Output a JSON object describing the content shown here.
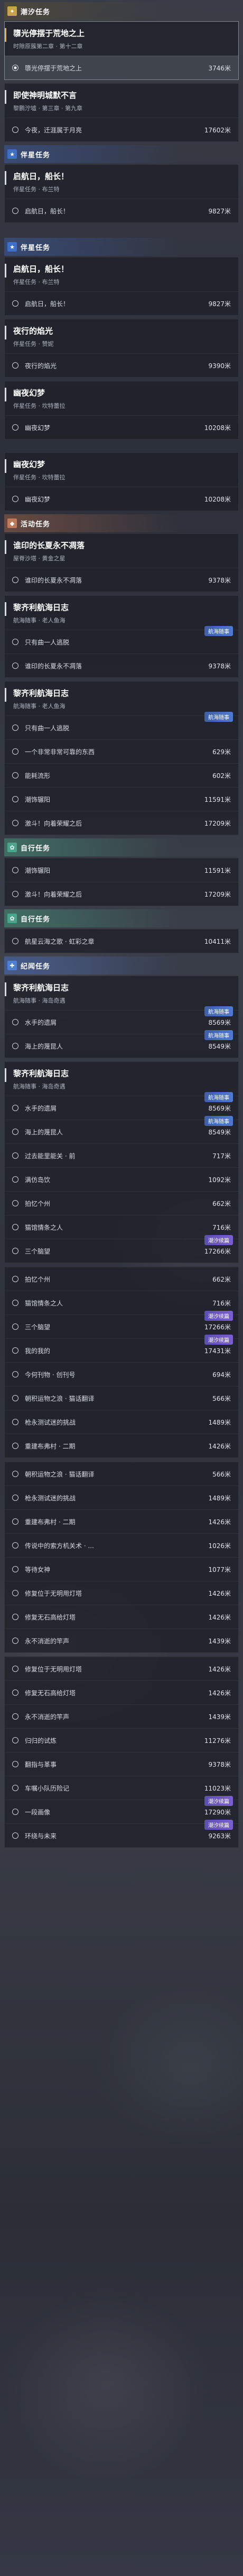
{
  "sections": [
    {
      "type": "header",
      "variant": "hc",
      "icon": "✦",
      "icon_name": "tide-task-icon",
      "title": "潮汐任务"
    },
    {
      "type": "card",
      "variant": "hc-card",
      "selected": true,
      "title": "隳光停摆于荒地之上",
      "subtitle": "时隙原簇第二章 · 第十二章",
      "steps": [
        {
          "text": "隳光停摆于荒地之上",
          "dist": "3746米",
          "marker": "dot",
          "highlight": true
        }
      ]
    },
    {
      "type": "card",
      "title": "即使神明城默不言",
      "subtitle": "黎鹏泞墟 · 第三章 · 第九章",
      "steps": [
        {
          "text": "今夜，迁涯属于月亮",
          "dist": "17602米"
        }
      ]
    },
    {
      "type": "header",
      "variant": "xq",
      "icon": "★",
      "icon_name": "companion-task-icon",
      "title": "伴星任务"
    },
    {
      "type": "card",
      "title": "启航日，船长！",
      "subtitle": "伴星任务 · 布兰特",
      "steps": [
        {
          "text": "启航日，船长！",
          "dist": "9827米"
        }
      ]
    },
    {
      "type": "gap"
    },
    {
      "type": "header",
      "variant": "xq",
      "icon": "★",
      "icon_name": "companion-task-icon",
      "title": "伴星任务"
    },
    {
      "type": "card",
      "title": "启航日，船长！",
      "subtitle": "伴星任务 · 布兰特",
      "steps": [
        {
          "text": "启航日，船长！",
          "dist": "9827米"
        }
      ]
    },
    {
      "type": "card",
      "title": "夜行的焰光",
      "subtitle": "伴星任务 · 赞妮",
      "steps": [
        {
          "text": "夜行的焰光",
          "dist": "9390米"
        }
      ]
    },
    {
      "type": "card",
      "title": "幽夜幻梦",
      "subtitle": "伴星任务 · 坎特蕾拉",
      "steps": [
        {
          "text": "幽夜幻梦",
          "dist": "10208米"
        }
      ]
    },
    {
      "type": "gap"
    },
    {
      "type": "card",
      "title": "幽夜幻梦",
      "subtitle": "伴星任务 · 坎特蕾拉",
      "steps": [
        {
          "text": "幽夜幻梦",
          "dist": "10208米"
        }
      ]
    },
    {
      "type": "header",
      "variant": "hd",
      "icon": "◆",
      "icon_name": "event-task-icon",
      "title": "活动任务"
    },
    {
      "type": "card",
      "title": "谁印的长夏永不凋落",
      "subtitle": "屋脊沙塔 · 黄金之星",
      "steps": [
        {
          "text": "谁印的长夏永不凋落",
          "dist": "9378米"
        }
      ]
    },
    {
      "type": "card",
      "title": "黎齐利航海日志",
      "subtitle": "航海随事 · 老人鱼海",
      "steps": [
        {
          "text": "只有曲一人逃脱",
          "tag": "航海随事",
          "tag_style": "link"
        },
        {
          "text": "谁印的长夏永不凋落",
          "dist": "9378米"
        }
      ]
    },
    {
      "type": "card",
      "title": "黎齐利航海日志",
      "subtitle": "航海随事 · 老人鱼海",
      "steps": [
        {
          "text": "只有曲一人逃脱",
          "tag": "航海随事",
          "tag_style": "link"
        },
        {
          "text": "一个非常非常可靠的东西",
          "dist": "629米"
        },
        {
          "text": "能耗流形",
          "dist": "602米"
        },
        {
          "text": "潮饰辗阳",
          "dist": "11591米"
        },
        {
          "text": "激斗！向着荣耀之后",
          "dist": "17209米"
        }
      ]
    },
    {
      "type": "header",
      "variant": "zx",
      "icon": "✿",
      "icon_name": "free-task-icon",
      "title": "自行任务"
    },
    {
      "type": "card",
      "title": "",
      "subtitle": "",
      "steps": [
        {
          "text": "潮饰辗阳",
          "dist": "11591米"
        },
        {
          "text": "激斗！向着荣耀之后",
          "dist": "17209米"
        }
      ]
    },
    {
      "type": "header",
      "variant": "zx",
      "icon": "✿",
      "icon_name": "free-task-icon",
      "title": "自行任务"
    },
    {
      "type": "card",
      "title": "",
      "subtitle": "",
      "steps": [
        {
          "text": "航星云海之歌 · 虹彩之章",
          "dist": "10411米"
        }
      ]
    },
    {
      "type": "header",
      "variant": "jl",
      "icon": "✚",
      "icon_name": "record-task-icon",
      "title": "纪闻任务"
    },
    {
      "type": "card",
      "title": "黎齐利航海日志",
      "subtitle": "航海随事 · 海岛奇遇",
      "steps": [
        {
          "text": "水手的遗屑",
          "dist": "8569米",
          "tag": "航海随事",
          "tag_style": "link"
        },
        {
          "text": "海上的蔑昆人",
          "dist": "8549米",
          "tag": "航海随事",
          "tag_style": "link"
        }
      ]
    },
    {
      "type": "card",
      "title": "黎齐利航海日志",
      "subtitle": "航海随事 · 海岛奇遇",
      "steps": [
        {
          "text": "水手的遗屑",
          "dist": "8569米",
          "tag": "航海随事",
          "tag_style": "link"
        },
        {
          "text": "海上的蔑昆人",
          "dist": "8549米",
          "tag": "航海随事",
          "tag_style": "link"
        },
        {
          "text": "过去能里能关 · 前",
          "dist": "717米"
        },
        {
          "text": "满仿岛饮",
          "dist": "1092米"
        },
        {
          "text": "拍忆个州",
          "dist": "662米"
        },
        {
          "text": "猫馆情条之人",
          "dist": "716米"
        },
        {
          "text": "三个脑望",
          "dist": "17266米",
          "tag": "潮汐续篇"
        }
      ]
    },
    {
      "type": "card",
      "title": "",
      "subtitle": "",
      "steps": [
        {
          "text": "拍忆个州",
          "dist": "662米"
        },
        {
          "text": "猫馆情条之人",
          "dist": "716米"
        },
        {
          "text": "三个脑望",
          "dist": "17266米",
          "tag": "潮汐续篇"
        },
        {
          "text": "我的我的",
          "dist": "17431米",
          "tag": "潮汐续篇"
        },
        {
          "text": "今何刊物 · 创刊号",
          "dist": "694米"
        },
        {
          "text": "朝积运物之浪 · 猫话翻译",
          "dist": "566米"
        },
        {
          "text": "枪永测试迷的挑战",
          "dist": "1489米"
        },
        {
          "text": "重建布弗村 · 二期",
          "dist": "1426米"
        }
      ]
    },
    {
      "type": "card",
      "title": "",
      "subtitle": "",
      "steps": [
        {
          "text": "朝积运物之浪 · 猫话翻译",
          "dist": "566米"
        },
        {
          "text": "枪永测试迷的挑战",
          "dist": "1489米"
        },
        {
          "text": "重建布弗村 · 二期",
          "dist": "1426米"
        },
        {
          "text": "传说中的索方机关术 · ...",
          "dist": "1026米"
        },
        {
          "text": "等待女神",
          "dist": "1077米"
        },
        {
          "text": "修复位于无明用灯塔",
          "dist": "1426米"
        },
        {
          "text": "修复无石高给灯塔",
          "dist": "1426米"
        },
        {
          "text": "永不消逝的竿声",
          "dist": "1439米"
        }
      ]
    },
    {
      "type": "card",
      "title": "",
      "subtitle": "",
      "steps": [
        {
          "text": "修复位于无明用灯塔",
          "dist": "1426米"
        },
        {
          "text": "修复无石高给灯塔",
          "dist": "1426米"
        },
        {
          "text": "永不消逝的竿声",
          "dist": "1439米"
        },
        {
          "text": "归归的试炼",
          "dist": "11276米"
        },
        {
          "text": "翻指与革事",
          "dist": "9378米"
        },
        {
          "text": "车嘱小队历险记",
          "dist": "11023米"
        },
        {
          "text": "一段画像",
          "dist": "17290米",
          "tag": "潮汐续篇"
        },
        {
          "text": "环绕与未来",
          "dist": "9263米",
          "tag": "潮汐续篇"
        }
      ]
    }
  ]
}
